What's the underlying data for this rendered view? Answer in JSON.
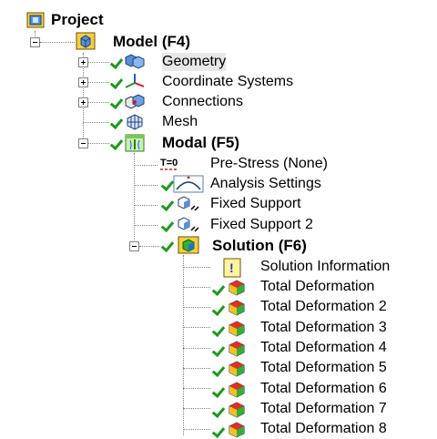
{
  "tree": {
    "root": {
      "label": "Project",
      "icon": "project-icon"
    },
    "model": {
      "label": "Model (F4)",
      "icon": "model-cube-icon"
    },
    "geometry": {
      "label": "Geometry",
      "icon": "geometry-cubes-icon"
    },
    "coordinate_systems": {
      "label": "Coordinate Systems",
      "icon": "coordinate-axes-icon"
    },
    "connections": {
      "label": "Connections",
      "icon": "connections-icon"
    },
    "mesh": {
      "label": "Mesh",
      "icon": "mesh-icon"
    },
    "modal": {
      "label": "Modal (F5)",
      "icon": "modal-analysis-icon"
    },
    "pre_stress": {
      "label": "Pre-Stress (None)",
      "icon": "pre-stress-icon",
      "icon_text": "T=0"
    },
    "analysis_settings": {
      "label": "Analysis Settings",
      "icon": "analysis-settings-icon"
    },
    "fixed_support_1": {
      "label": "Fixed Support",
      "icon": "fixed-support-icon"
    },
    "fixed_support_2": {
      "label": "Fixed Support 2",
      "icon": "fixed-support-icon"
    },
    "solution": {
      "label": "Solution (F6)",
      "icon": "solution-icon"
    },
    "solution_information": {
      "label": "Solution Information",
      "icon": "info-icon",
      "icon_text": "!"
    },
    "deformations": [
      "Total Deformation",
      "Total Deformation 2",
      "Total Deformation 3",
      "Total Deformation 4",
      "Total Deformation 5",
      "Total Deformation 6",
      "Total Deformation 7",
      "Total Deformation 8"
    ]
  },
  "colors": {
    "check_green": "#1c9a1c",
    "connector_gray": "#808080",
    "selection_bg": "#e8e8e8"
  }
}
